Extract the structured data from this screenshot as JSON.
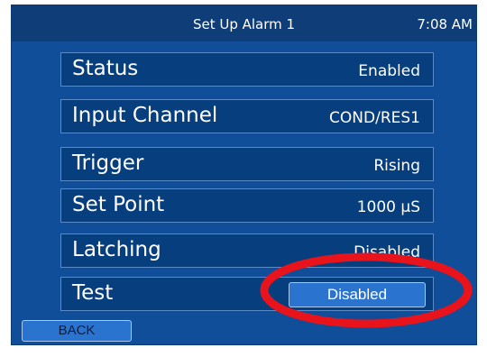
{
  "header": {
    "title": "Set Up Alarm 1",
    "time": "7:08 AM"
  },
  "settings": [
    {
      "label": "Status",
      "value": "Enabled"
    },
    {
      "label": "Input Channel",
      "value": "COND/RES1"
    },
    {
      "label": "Trigger",
      "value": "Rising"
    },
    {
      "label": "Set Point",
      "value": "1000 μS"
    },
    {
      "label": "Latching",
      "value": "Disabled"
    },
    {
      "label": "Test",
      "value": "Disabled"
    }
  ],
  "footer": {
    "back_label": "BACK"
  },
  "colors": {
    "panel_background": "#104E9A",
    "title_bar": "#0E3D78",
    "row_background": "#073E7E",
    "button": "#2A74CF",
    "highlight": "#E8131B"
  },
  "annotation": {
    "shape": "ellipse",
    "color": "#E8131B",
    "target": "test-button"
  }
}
